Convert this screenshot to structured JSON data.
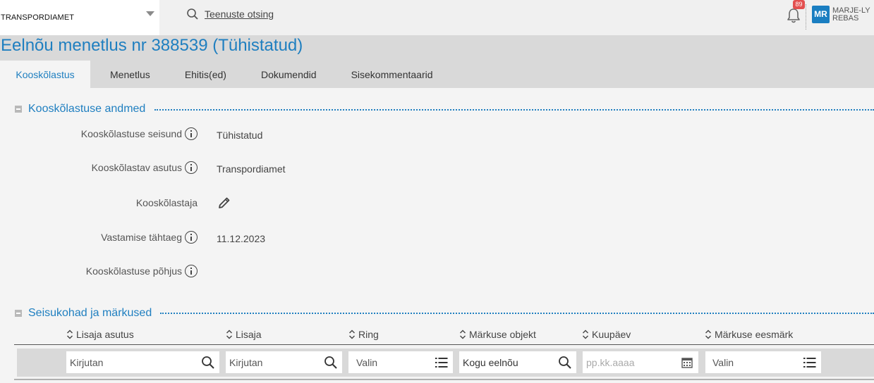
{
  "header": {
    "organization": "TRANSPORDIAMET",
    "search_label": "Teenuste otsing",
    "notification_count": "89",
    "user_initials": "MR",
    "user_name_line1": "MARJE-LY",
    "user_name_line2": "REBAS"
  },
  "page": {
    "title": "Eelnõu menetlus nr 388539 (Tühistatud)"
  },
  "tabs": [
    {
      "label": "Kooskõlastus",
      "active": true
    },
    {
      "label": "Menetlus",
      "active": false
    },
    {
      "label": "Ehitis(ed)",
      "active": false
    },
    {
      "label": "Dokumendid",
      "active": false
    },
    {
      "label": "Sisekommentaarid",
      "active": false
    }
  ],
  "section_details": {
    "title": "Kooskõlastuse andmed",
    "fields": [
      {
        "label": "Kooskõlastuse seisund",
        "value": "Tühistatud",
        "info": true
      },
      {
        "label": "Kooskõlastav asutus",
        "value": "Transpordiamet",
        "info": true
      },
      {
        "label": "Kooskõlastaja",
        "value": "",
        "editable": true
      },
      {
        "label": "Vastamise tähtaeg",
        "value": "11.12.2023",
        "info": true
      },
      {
        "label": "Kooskõlastuse põhjus",
        "value": "",
        "info": true
      }
    ]
  },
  "section_remarks": {
    "title": "Seisukohad ja märkused",
    "columns": [
      "Lisaja asutus",
      "Lisaja",
      "Ring",
      "Märkuse objekt",
      "Kuupäev",
      "Märkuse eesmärk"
    ],
    "filters": [
      {
        "placeholder": "Kirjutan",
        "value": "",
        "icon": "search-icon"
      },
      {
        "placeholder": "Kirjutan",
        "value": "",
        "icon": "search-icon"
      },
      {
        "placeholder": "Valin",
        "value": "",
        "icon": "list-icon"
      },
      {
        "placeholder": "",
        "value": "Kogu eelnõu",
        "icon": "search-icon"
      },
      {
        "placeholder": "pp.kk.aaaa",
        "value": "",
        "icon": "calendar-icon"
      },
      {
        "placeholder": "Valin",
        "value": "",
        "icon": "list-icon"
      }
    ]
  },
  "colors": {
    "accent": "#1f7fc0",
    "badge": "#e35050",
    "avatar": "#1a7ec1"
  }
}
